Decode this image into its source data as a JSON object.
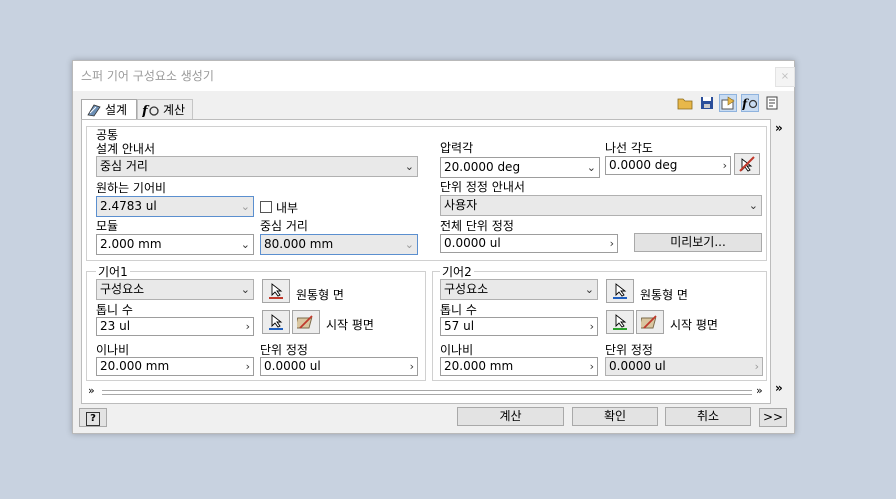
{
  "window": {
    "title": "스퍼 기어 구성요소 생성기",
    "close": "×"
  },
  "tabs": [
    {
      "label": "설계"
    },
    {
      "label": "계산"
    }
  ],
  "common": {
    "group_label": "공통",
    "design_guide": {
      "label": "설계 안내서",
      "value": "중심 거리"
    },
    "pressure_angle": {
      "label": "압력각",
      "value": "20.0000 deg"
    },
    "helix_angle": {
      "label": "나선 각도",
      "value": "0.0000 deg"
    },
    "desired_ratio": {
      "label": "원하는 기어비",
      "value": "2.4783 ul"
    },
    "internal": {
      "label": "내부"
    },
    "unit_correction_guide": {
      "label": "단위 정정 안내서",
      "value": "사용자"
    },
    "module": {
      "label": "모듈",
      "value": "2.000 mm"
    },
    "center_distance": {
      "label": "중심 거리",
      "value": "80.000 mm"
    },
    "total_unit_correction": {
      "label": "전체 단위 정정",
      "value": "0.0000 ul"
    },
    "preview_button": "미리보기..."
  },
  "gear1": {
    "group_label": "기어1",
    "type": "구성요소",
    "cylinder_face": "원통형 면",
    "teeth_label": "톱니 수",
    "teeth_value": "23 ul",
    "start_plane": "시작 평면",
    "face_width_label": "이나비",
    "face_width_value": "20.000 mm",
    "unit_correction_label": "단위 정정",
    "unit_correction_value": "0.0000 ul"
  },
  "gear2": {
    "group_label": "기어2",
    "type": "구성요소",
    "cylinder_face": "원통형 면",
    "teeth_label": "톱니 수",
    "teeth_value": "57 ul",
    "start_plane": "시작 평면",
    "face_width_label": "이나비",
    "face_width_value": "20.000 mm",
    "unit_correction_label": "단위 정정",
    "unit_correction_value": "0.0000 ul"
  },
  "footer": {
    "help": "?",
    "calculate": "계산",
    "ok": "확인",
    "cancel": "취소",
    "more": ">>"
  },
  "colors": {
    "accent_blue": "#1f5fbf",
    "pick_red": "#c0392b",
    "pick_green": "#2ca02c"
  }
}
